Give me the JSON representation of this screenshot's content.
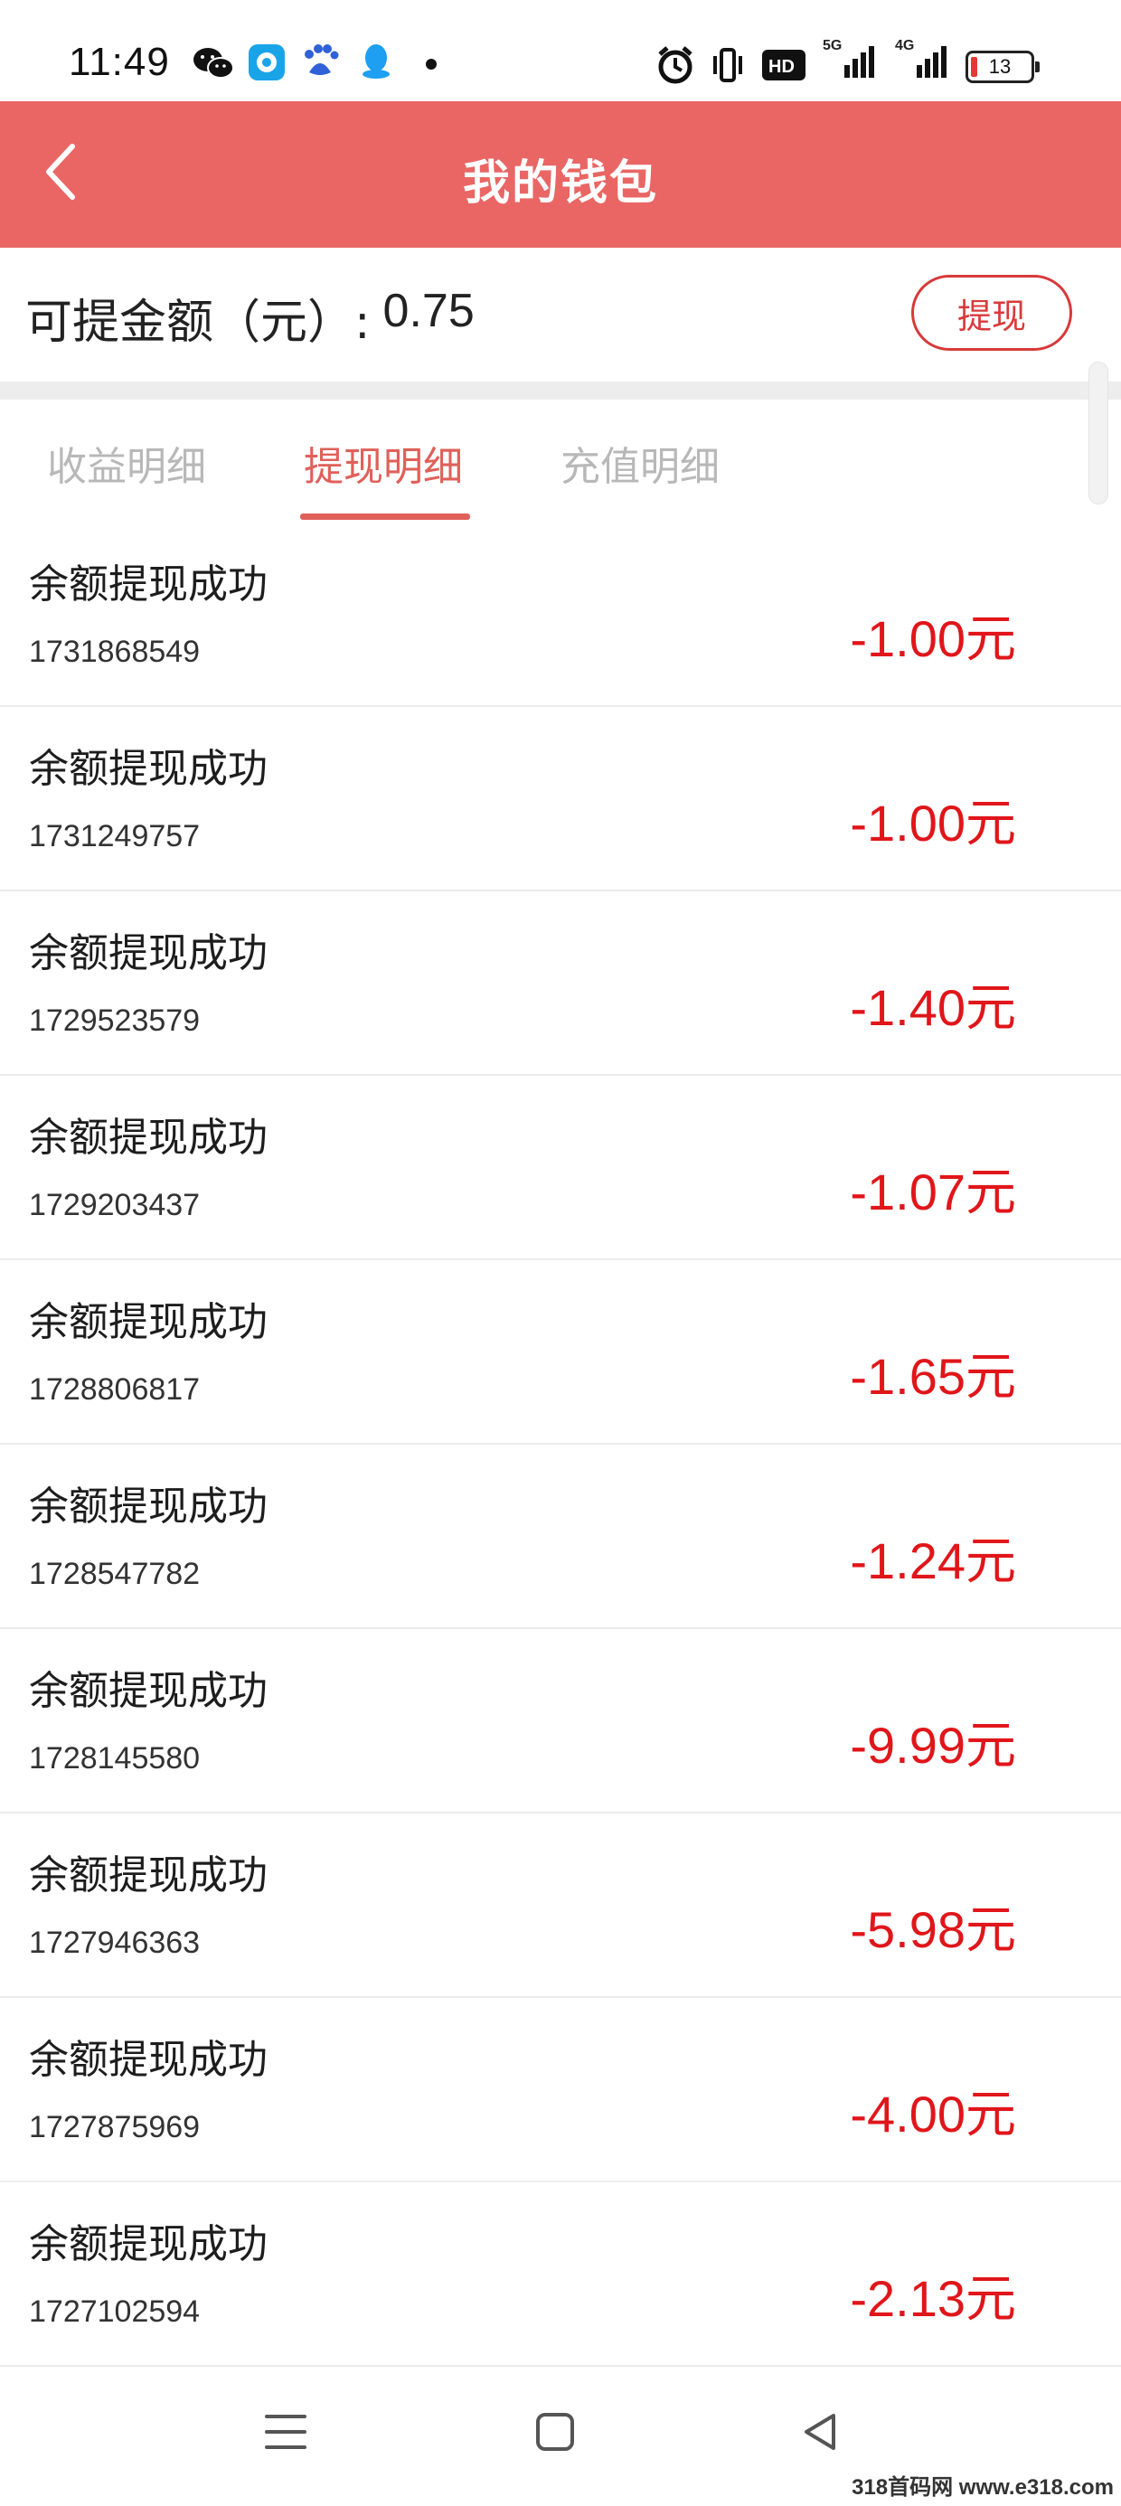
{
  "status_bar": {
    "time": "11:49",
    "signal_5g": "5G",
    "signal_4g": "4G",
    "battery": "13",
    "icons": [
      "wechat-icon",
      "app-icon",
      "baidu-icon",
      "qq-icon",
      "dot-icon",
      "alarm-icon",
      "vibrate-icon",
      "hd-icon",
      "signal-5g-icon",
      "signal-4g-icon",
      "battery-icon"
    ]
  },
  "header": {
    "title": "我的钱包",
    "back_icon": "chevron-left-icon"
  },
  "balance": {
    "label": "可提金额（元）:",
    "value": "0.75",
    "withdraw_label": "提现"
  },
  "tabs": [
    {
      "label": "收益明细",
      "active": false
    },
    {
      "label": "提现明细",
      "active": true
    },
    {
      "label": "充值明细",
      "active": false
    }
  ],
  "colors": {
    "header": "#e96664",
    "accent": "#e0605a",
    "amount": "#e0161a"
  },
  "records": [
    {
      "title": "余额提现成功",
      "id": "1731868549",
      "amount": "-1.00",
      "unit": "元"
    },
    {
      "title": "余额提现成功",
      "id": "1731249757",
      "amount": "-1.00",
      "unit": "元"
    },
    {
      "title": "余额提现成功",
      "id": "1729523579",
      "amount": "-1.40",
      "unit": "元"
    },
    {
      "title": "余额提现成功",
      "id": "1729203437",
      "amount": "-1.07",
      "unit": "元"
    },
    {
      "title": "余额提现成功",
      "id": "1728806817",
      "amount": "-1.65",
      "unit": "元"
    },
    {
      "title": "余额提现成功",
      "id": "1728547782",
      "amount": "-1.24",
      "unit": "元"
    },
    {
      "title": "余额提现成功",
      "id": "1728145580",
      "amount": "-9.99",
      "unit": "元"
    },
    {
      "title": "余额提现成功",
      "id": "1727946363",
      "amount": "-5.98",
      "unit": "元"
    },
    {
      "title": "余额提现成功",
      "id": "1727875969",
      "amount": "-4.00",
      "unit": "元"
    },
    {
      "title": "余额提现成功",
      "id": "1727102594",
      "amount": "-2.13",
      "unit": "元"
    }
  ],
  "nav": {
    "icons": [
      "menu-icon",
      "home-icon",
      "back-triangle-icon"
    ]
  },
  "watermark": "318首码网 www.e318.com"
}
